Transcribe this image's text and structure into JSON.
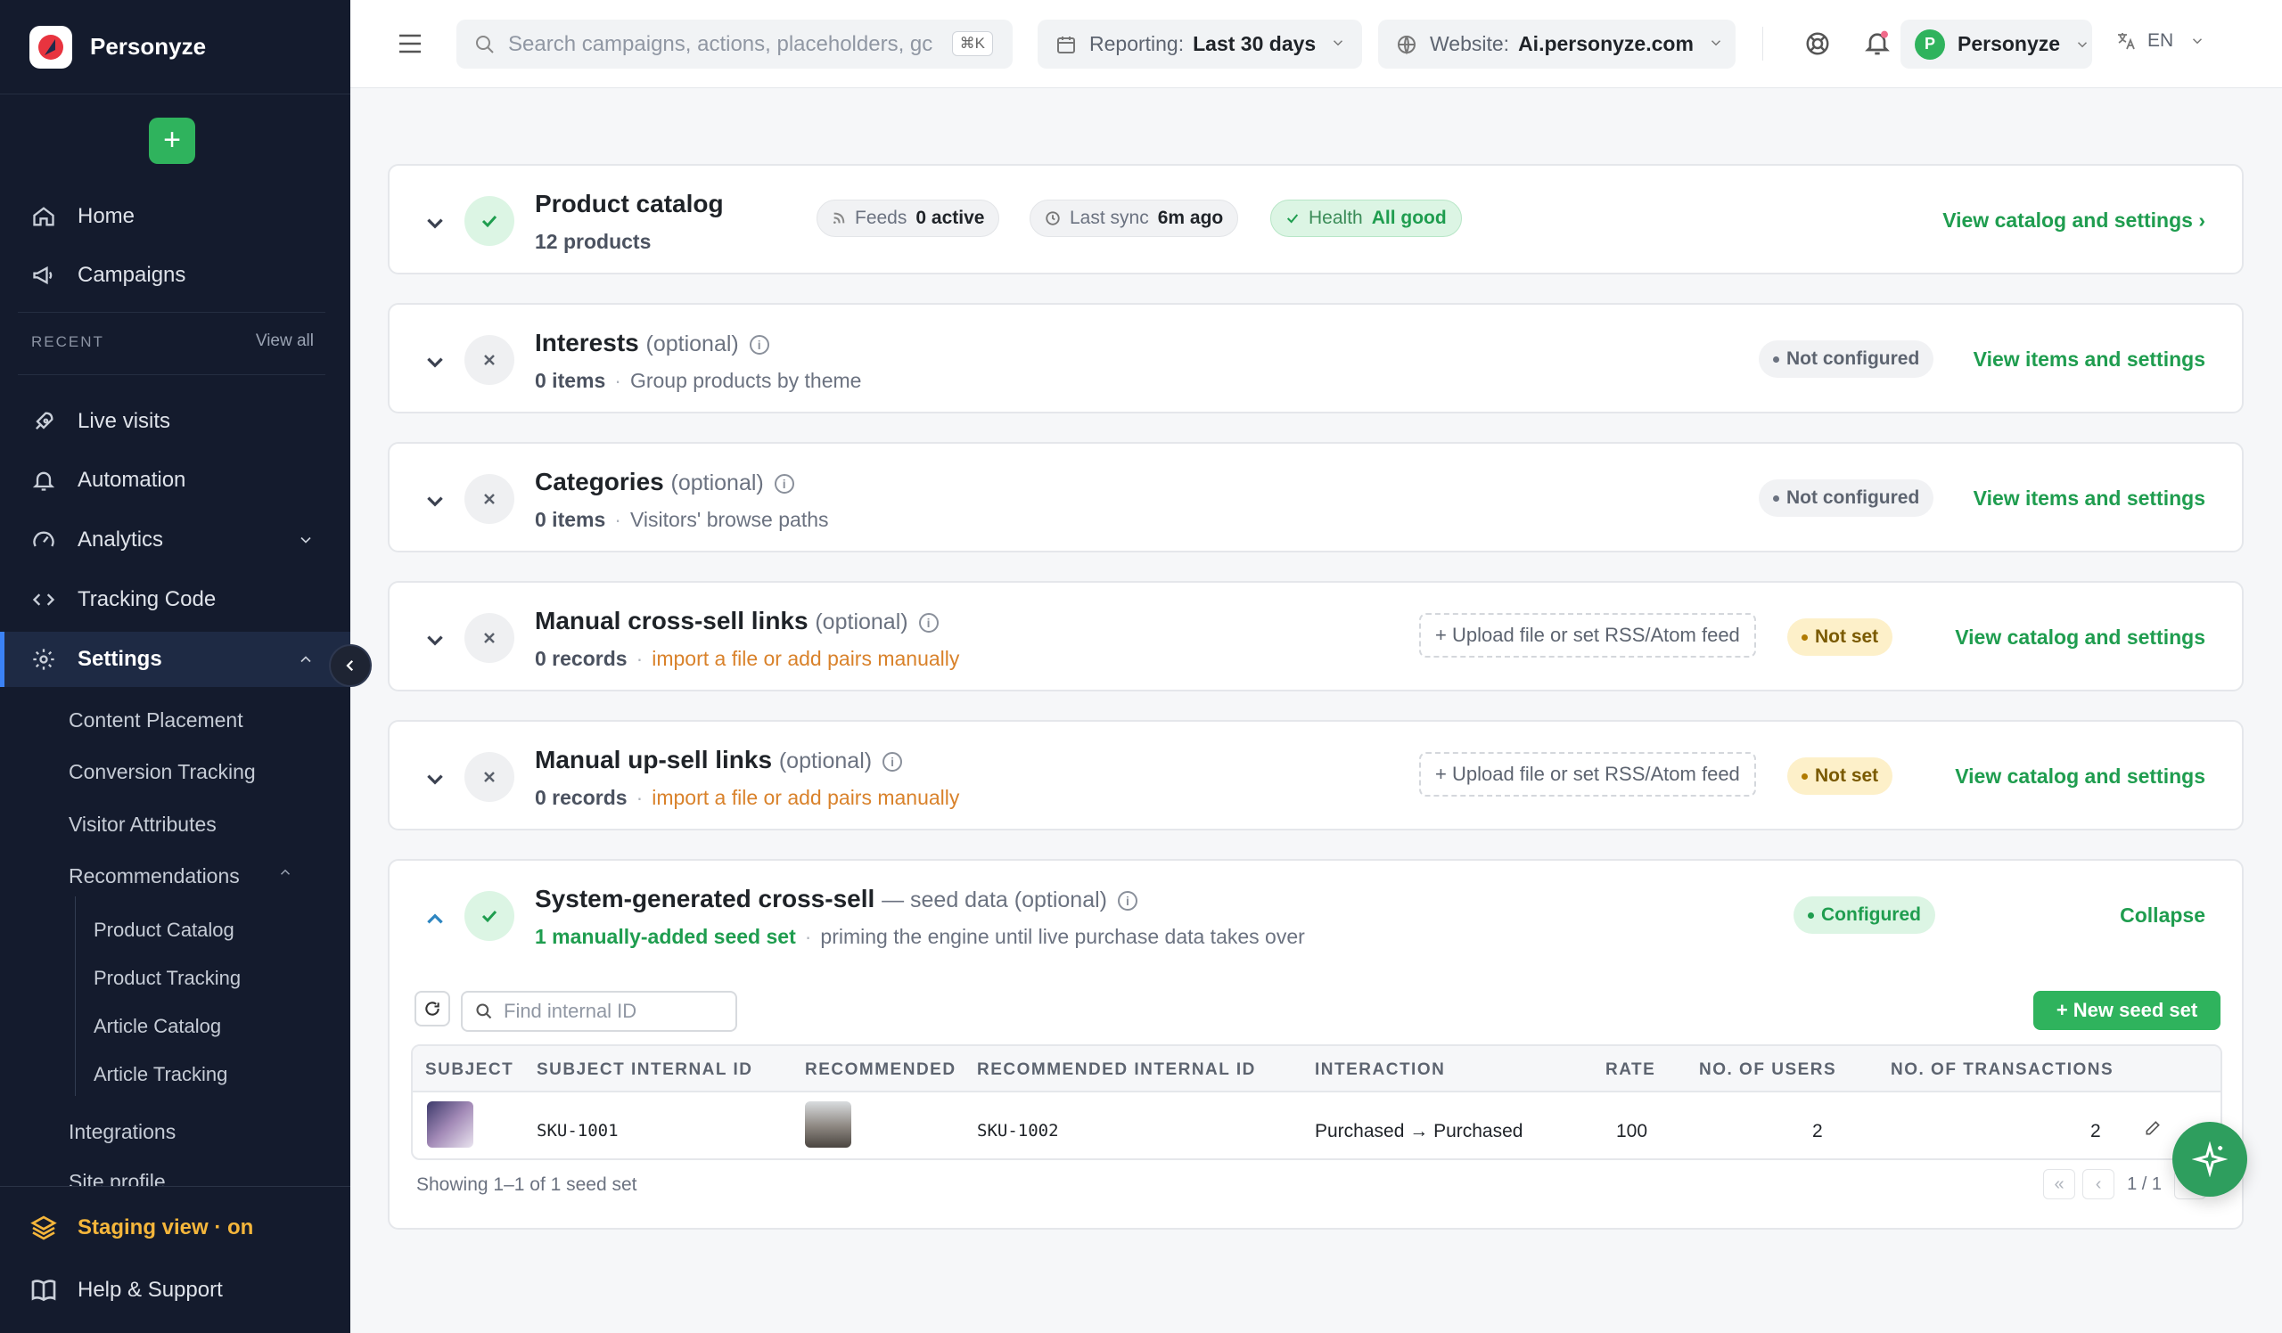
{
  "brand": {
    "name": "Personyze"
  },
  "sidebar": {
    "home": "Home",
    "campaigns": "Campaigns",
    "recent_label": "RECENT",
    "recent_link": "View all",
    "items": {
      "live_visits": "Live visits",
      "automation": "Automation",
      "analytics": "Analytics",
      "tracking_code": "Tracking Code",
      "settings": "Settings"
    },
    "settings_sub": {
      "content_placement": "Content Placement",
      "conversion_tracking": "Conversion Tracking",
      "visitor_attributes": "Visitor Attributes",
      "recommendations": "Recommendations",
      "product_catalog": "Product Catalog",
      "product_tracking": "Product Tracking",
      "article_catalog": "Article Catalog",
      "article_tracking": "Article Tracking",
      "integrations": "Integrations",
      "site_profile": "Site profile"
    },
    "staging": "Staging view · on",
    "help": "Help & Support"
  },
  "topbar": {
    "search_placeholder": "Search campaigns, actions, placeholders, gc",
    "search_kbd": "⌘K",
    "reporting_label": "Reporting:",
    "reporting_value": "Last 30 days",
    "website_label": "Website:",
    "website_value": "Ai.personyze.com",
    "user_initial": "P",
    "user_name": "Personyze",
    "lang": "EN"
  },
  "cards": {
    "product_catalog": {
      "title": "Product catalog",
      "count": "12 products",
      "feeds_label": "Feeds",
      "feeds_value": "0 active",
      "sync_label": "Last sync",
      "sync_value": "6m ago",
      "health_label": "Health",
      "health_value": "All good",
      "link": "View catalog and settings ›"
    },
    "interests": {
      "title": "Interests",
      "optional": "(optional)",
      "count": "0 items",
      "desc": "Group products by theme",
      "badge": "Not configured",
      "link": "View items and settings"
    },
    "categories": {
      "title": "Categories",
      "optional": "(optional)",
      "count": "0 items",
      "desc": "Visitors' browse paths",
      "badge": "Not configured",
      "link": "View items and settings"
    },
    "cross_sell": {
      "title": "Manual cross-sell links",
      "optional": "(optional)",
      "count": "0 records",
      "desc": "import a file or add pairs manually",
      "upload": "+ Upload file or set RSS/Atom feed",
      "badge": "Not set",
      "link": "View catalog and settings"
    },
    "up_sell": {
      "title": "Manual up-sell links",
      "optional": "(optional)",
      "count": "0 records",
      "desc": "import a file or add pairs manually",
      "upload": "+ Upload file or set RSS/Atom feed",
      "badge": "Not set",
      "link": "View catalog and settings"
    },
    "system_cross_sell": {
      "title": "System-generated cross-sell",
      "optional": "— seed data (optional)",
      "count": "1 manually-added seed set",
      "desc": "priming the engine until live purchase data takes over",
      "badge": "Configured",
      "link": "Collapse",
      "find_placeholder": "Find internal ID",
      "new_button": "+ New seed set",
      "columns": [
        "SUBJECT",
        "SUBJECT INTERNAL ID",
        "RECOMMENDED",
        "RECOMMENDED INTERNAL ID",
        "INTERACTION",
        "RATE",
        "NO. OF USERS",
        "NO. OF TRANSACTIONS"
      ],
      "rows": [
        {
          "subject_id": "SKU-1001",
          "recommended_id": "SKU-1002",
          "interaction": "Purchased → Purchased",
          "rate": "100",
          "users": "2",
          "transactions": "2"
        }
      ],
      "footer": "Showing 1–1 of 1 seed set",
      "page": "1 / 1"
    }
  },
  "colors": {
    "accent_green": "#1f9d4f",
    "sidebar_bg": "#141b2d",
    "staging_yellow": "#f5b63b"
  }
}
